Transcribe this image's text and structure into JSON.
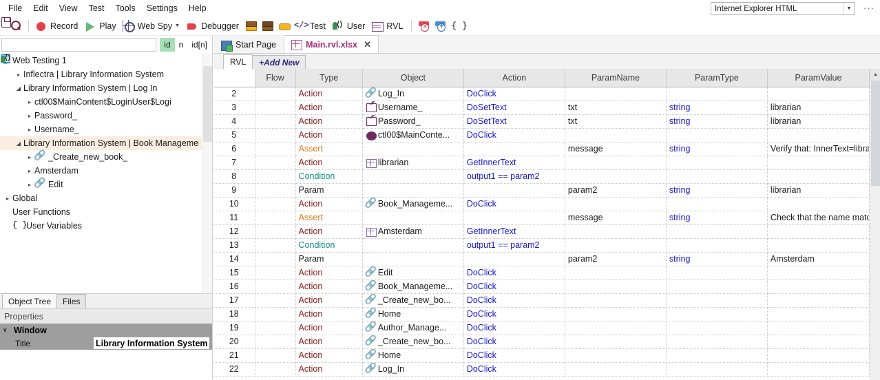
{
  "menubar": {
    "items": [
      "File",
      "Edit",
      "View",
      "Test",
      "Tools",
      "Settings",
      "Help"
    ],
    "browser_select": {
      "value": "Internet Explorer HTML",
      "arrow": "chevron-down-icon"
    },
    "overflow": "…"
  },
  "toolbar": {
    "buttons": [
      {
        "name": "save-button",
        "icon": "save-icon",
        "label": ""
      },
      {
        "name": "find-button",
        "icon": "search-icon",
        "label": ""
      },
      {
        "name": "record-button",
        "icon": "record-icon",
        "label": "Record"
      },
      {
        "name": "play-button",
        "icon": "play-icon",
        "label": "Play"
      },
      {
        "name": "web-spy-button",
        "icon": "crosshair-icon",
        "label": "Web Spy",
        "has_caret": true
      },
      {
        "name": "debugger-button",
        "icon": "flag-icon",
        "label": "Debugger"
      },
      {
        "name": "stack-yellow-button",
        "icon": "stack-yellow-icon",
        "label": ""
      },
      {
        "name": "stack-brown-button",
        "icon": "stack-brown-icon",
        "label": ""
      },
      {
        "name": "disk-button",
        "icon": "disk-icon",
        "label": ""
      },
      {
        "name": "test-code-button",
        "icon": "code-tags-icon",
        "label": "Test"
      },
      {
        "name": "user-button",
        "icon": "user-code-icon",
        "label": "User"
      },
      {
        "name": "rvl-button",
        "icon": "grid-table-icon",
        "label": "RVL"
      },
      {
        "name": "delete-row-button",
        "icon": "delete-row-icon",
        "label": ""
      },
      {
        "name": "insert-row-button",
        "icon": "insert-row-icon",
        "label": ""
      },
      {
        "name": "variables-button",
        "icon": "braces-icon",
        "label": ""
      }
    ]
  },
  "left_panel": {
    "search": {
      "value": "",
      "placeholder": ""
    },
    "id_buttons": [
      {
        "label": "id",
        "active": true
      },
      {
        "label": "n",
        "active": false
      },
      {
        "label": "id[n]",
        "active": false
      }
    ],
    "tree": [
      {
        "depth": 0,
        "twist": "◢",
        "icon": "shield-icon",
        "label": "Web Testing 1",
        "selected": false
      },
      {
        "depth": 1,
        "twist": "▸",
        "icon": "window-icon",
        "label": "Inflectra | Library Information System",
        "selected": false
      },
      {
        "depth": 1,
        "twist": "◢",
        "icon": "window-icon",
        "label": "Library Information System | Log In",
        "selected": false
      },
      {
        "depth": 2,
        "twist": "▸",
        "icon": "ellipse-icon",
        "label": "ctl00$MainContent$LoginUser$Logi",
        "selected": false
      },
      {
        "depth": 2,
        "twist": "▸",
        "icon": "textbox-icon",
        "label": "Password_",
        "selected": false
      },
      {
        "depth": 2,
        "twist": "▸",
        "icon": "textbox-icon",
        "label": "Username_",
        "selected": false
      },
      {
        "depth": 1,
        "twist": "◢",
        "icon": "window-icon",
        "label": "Library Information System | Book Management",
        "selected": true
      },
      {
        "depth": 2,
        "twist": "▸",
        "icon": "link-icon",
        "label": "_Create_new_book_",
        "selected": false
      },
      {
        "depth": 2,
        "twist": "▸",
        "icon": "table-icon",
        "label": "Amsterdam",
        "selected": false
      },
      {
        "depth": 2,
        "twist": "▸",
        "icon": "link-icon",
        "label": "Edit",
        "selected": false
      },
      {
        "depth": 0,
        "twist": "▸",
        "icon": "window-icon",
        "label": "Global",
        "selected": false
      },
      {
        "depth": 0,
        "twist": "",
        "icon": "user-functions-icon",
        "label": "User Functions",
        "selected": false
      },
      {
        "depth": 0,
        "twist": "",
        "icon": "braces-icon",
        "label": "User Variables",
        "selected": false
      }
    ],
    "tabs": [
      {
        "label": "Object Tree",
        "active": true
      },
      {
        "label": "Files",
        "active": false
      }
    ],
    "properties": {
      "header": "Properties",
      "group_twist": "∨",
      "group_label": "Window",
      "rows": [
        {
          "name": "Title",
          "value": "Library Information System | B"
        }
      ]
    }
  },
  "main": {
    "doc_tabs": [
      {
        "label": "Start Page",
        "icon": "start-page-icon",
        "active": false,
        "closable": false
      },
      {
        "label": "Main.rvl.xlsx",
        "icon": "xlsx-icon",
        "active": true,
        "closable": true,
        "close": "✕"
      }
    ],
    "sheet_tabs": [
      {
        "label": "RVL",
        "active": true,
        "kind": "sheet"
      },
      {
        "label": "+Add New",
        "active": false,
        "kind": "addnew"
      }
    ],
    "grid": {
      "columns": [
        "",
        "Flow",
        "Type",
        "Object",
        "Action",
        "ParamName",
        "ParamType",
        "ParamValue",
        ""
      ],
      "rows": [
        {
          "num": "2",
          "flow": "",
          "type": "Action",
          "type_kind": "action",
          "object": "Log_In",
          "object_icon": "link-icon",
          "action": "DoClick",
          "pname": "",
          "ptype": "",
          "pvalue": ""
        },
        {
          "num": "3",
          "flow": "",
          "type": "Action",
          "type_kind": "action",
          "object": "Username_",
          "object_icon": "textbox-icon",
          "action": "DoSetText",
          "pname": "txt",
          "ptype": "string",
          "pvalue": "librarian"
        },
        {
          "num": "4",
          "flow": "",
          "type": "Action",
          "type_kind": "action",
          "object": "Password_",
          "object_icon": "textbox-icon",
          "action": "DoSetText",
          "pname": "txt",
          "ptype": "string",
          "pvalue": "librarian"
        },
        {
          "num": "5",
          "flow": "",
          "type": "Action",
          "type_kind": "action",
          "object": "ctl00$MainConte...",
          "object_icon": "ellipse-icon",
          "action": "DoClick",
          "pname": "",
          "ptype": "",
          "pvalue": ""
        },
        {
          "num": "6",
          "flow": "",
          "type": "Assert",
          "type_kind": "assert",
          "object": "",
          "object_icon": "",
          "action": "",
          "pname": "message",
          "ptype": "string",
          "pvalue": "Verify that: InnerText=libra"
        },
        {
          "num": "7",
          "flow": "",
          "type": "Action",
          "type_kind": "action",
          "object": "librarian",
          "object_icon": "table-icon",
          "action": "GetInnerText",
          "pname": "",
          "ptype": "",
          "pvalue": ""
        },
        {
          "num": "8",
          "flow": "",
          "type": "Condition",
          "type_kind": "condition",
          "object": "",
          "object_icon": "",
          "action": "output1 == param2",
          "pname": "",
          "ptype": "",
          "pvalue": ""
        },
        {
          "num": "9",
          "flow": "",
          "type": "Param",
          "type_kind": "param",
          "object": "",
          "object_icon": "",
          "action": "",
          "pname": "param2",
          "ptype": "string",
          "pvalue": "librarian"
        },
        {
          "num": "10",
          "flow": "",
          "type": "Action",
          "type_kind": "action",
          "object": "Book_Manageme...",
          "object_icon": "link-icon",
          "action": "DoClick",
          "pname": "",
          "ptype": "",
          "pvalue": ""
        },
        {
          "num": "11",
          "flow": "",
          "type": "Assert",
          "type_kind": "assert",
          "object": "",
          "object_icon": "",
          "action": "",
          "pname": "message",
          "ptype": "string",
          "pvalue": "Check that the name matc"
        },
        {
          "num": "12",
          "flow": "",
          "type": "Action",
          "type_kind": "action",
          "object": "Amsterdam",
          "object_icon": "table-icon",
          "action": "GetInnerText",
          "pname": "",
          "ptype": "",
          "pvalue": ""
        },
        {
          "num": "13",
          "flow": "",
          "type": "Condition",
          "type_kind": "condition",
          "object": "",
          "object_icon": "",
          "action": "output1 == param2",
          "pname": "",
          "ptype": "",
          "pvalue": ""
        },
        {
          "num": "14",
          "flow": "",
          "type": "Param",
          "type_kind": "param",
          "object": "",
          "object_icon": "",
          "action": "",
          "pname": "param2",
          "ptype": "string",
          "pvalue": "Amsterdam"
        },
        {
          "num": "15",
          "flow": "",
          "type": "Action",
          "type_kind": "action",
          "object": "Edit",
          "object_icon": "link-icon",
          "action": "DoClick",
          "pname": "",
          "ptype": "",
          "pvalue": ""
        },
        {
          "num": "16",
          "flow": "",
          "type": "Action",
          "type_kind": "action",
          "object": "Book_Manageme...",
          "object_icon": "link-icon",
          "action": "DoClick",
          "pname": "",
          "ptype": "",
          "pvalue": ""
        },
        {
          "num": "17",
          "flow": "",
          "type": "Action",
          "type_kind": "action",
          "object": "_Create_new_bo...",
          "object_icon": "link-icon",
          "action": "DoClick",
          "pname": "",
          "ptype": "",
          "pvalue": ""
        },
        {
          "num": "18",
          "flow": "",
          "type": "Action",
          "type_kind": "action",
          "object": "Home",
          "object_icon": "link-icon",
          "action": "DoClick",
          "pname": "",
          "ptype": "",
          "pvalue": ""
        },
        {
          "num": "19",
          "flow": "",
          "type": "Action",
          "type_kind": "action",
          "object": "Author_Manage...",
          "object_icon": "link-icon",
          "action": "DoClick",
          "pname": "",
          "ptype": "",
          "pvalue": ""
        },
        {
          "num": "20",
          "flow": "",
          "type": "Action",
          "type_kind": "action",
          "object": "_Create_new_bo...",
          "object_icon": "link-icon",
          "action": "DoClick",
          "pname": "",
          "ptype": "",
          "pvalue": ""
        },
        {
          "num": "21",
          "flow": "",
          "type": "Action",
          "type_kind": "action",
          "object": "Home",
          "object_icon": "link-icon",
          "action": "DoClick",
          "pname": "",
          "ptype": "",
          "pvalue": ""
        },
        {
          "num": "22",
          "flow": "",
          "type": "Action",
          "type_kind": "action",
          "object": "Log_In",
          "object_icon": "link-icon",
          "action": "DoClick",
          "pname": "",
          "ptype": "",
          "pvalue": ""
        }
      ]
    },
    "scroll_up_arrow": "▲"
  },
  "colors": {
    "accent": "#a32d7b",
    "action": "#8c2020",
    "assert": "#e07b1a",
    "condition": "#0f8a8a",
    "link_blue": "#1515d0",
    "selection": "#fbeee0",
    "id_active": "#a6dfb8"
  }
}
